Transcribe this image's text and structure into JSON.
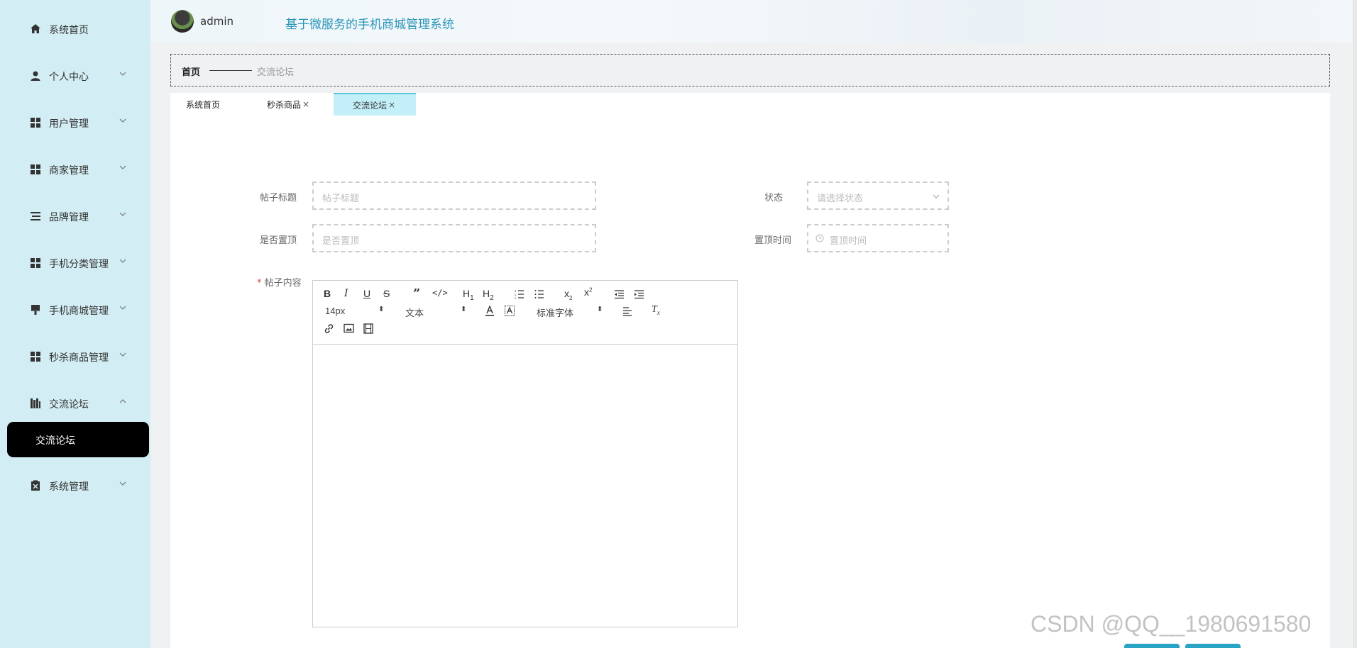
{
  "header": {
    "username": "admin",
    "site_title": "基于微服务的手机商城管理系统"
  },
  "sidebar": {
    "items": [
      {
        "label": "系统首页",
        "icon": "home-icon",
        "expand": "none"
      },
      {
        "label": "个人中心",
        "icon": "user-icon",
        "expand": "down"
      },
      {
        "label": "用户管理",
        "icon": "grid-icon",
        "expand": "down"
      },
      {
        "label": "商家管理",
        "icon": "grid-icon",
        "expand": "down"
      },
      {
        "label": "品牌管理",
        "icon": "list-icon",
        "expand": "down"
      },
      {
        "label": "手机分类管理",
        "icon": "grid-icon",
        "expand": "down"
      },
      {
        "label": "手机商城管理",
        "icon": "brush-icon",
        "expand": "down"
      },
      {
        "label": "秒杀商品管理",
        "icon": "grid-icon",
        "expand": "down"
      },
      {
        "label": "交流论坛",
        "icon": "books-icon",
        "expand": "up"
      },
      {
        "label": "系统管理",
        "icon": "clipboard-icon",
        "expand": "down"
      }
    ],
    "active_sub": "交流论坛"
  },
  "breadcrumb": {
    "home": "首页",
    "current": "交流论坛"
  },
  "tabs": [
    {
      "label": "系统首页",
      "closable": false,
      "active": false
    },
    {
      "label": "秒杀商品",
      "closable": true,
      "active": false
    },
    {
      "label": "交流论坛",
      "closable": true,
      "active": true
    }
  ],
  "tab_close_glyph": "×",
  "form": {
    "title_label": "帖子标题",
    "title_placeholder": "帖子标题",
    "status_label": "状态",
    "status_placeholder": "请选择状态",
    "top_label": "是否置顶",
    "top_placeholder": "是否置顶",
    "top_time_label": "置顶时间",
    "top_time_placeholder": "置顶时间",
    "content_required_mark": "*",
    "content_label": "帖子内容"
  },
  "editor": {
    "font_size": "14px",
    "header_type": "文本",
    "font_family": "标准字体",
    "buttons": [
      "bold",
      "italic",
      "underline",
      "strike",
      "blockquote",
      "code-block",
      "h1",
      "h2",
      "ordered-list",
      "bullet-list",
      "subscript",
      "superscript",
      "outdent",
      "indent",
      "font-color",
      "background-color",
      "align",
      "clean",
      "link",
      "image",
      "video"
    ]
  },
  "watermark": "CSDN @QQ__1980691580",
  "colors": {
    "sidebar_bg": "#d2edf3",
    "active_tab_bg": "#c3eff8",
    "title_color": "#2a95b8",
    "active_sub_bg": "#000000"
  }
}
